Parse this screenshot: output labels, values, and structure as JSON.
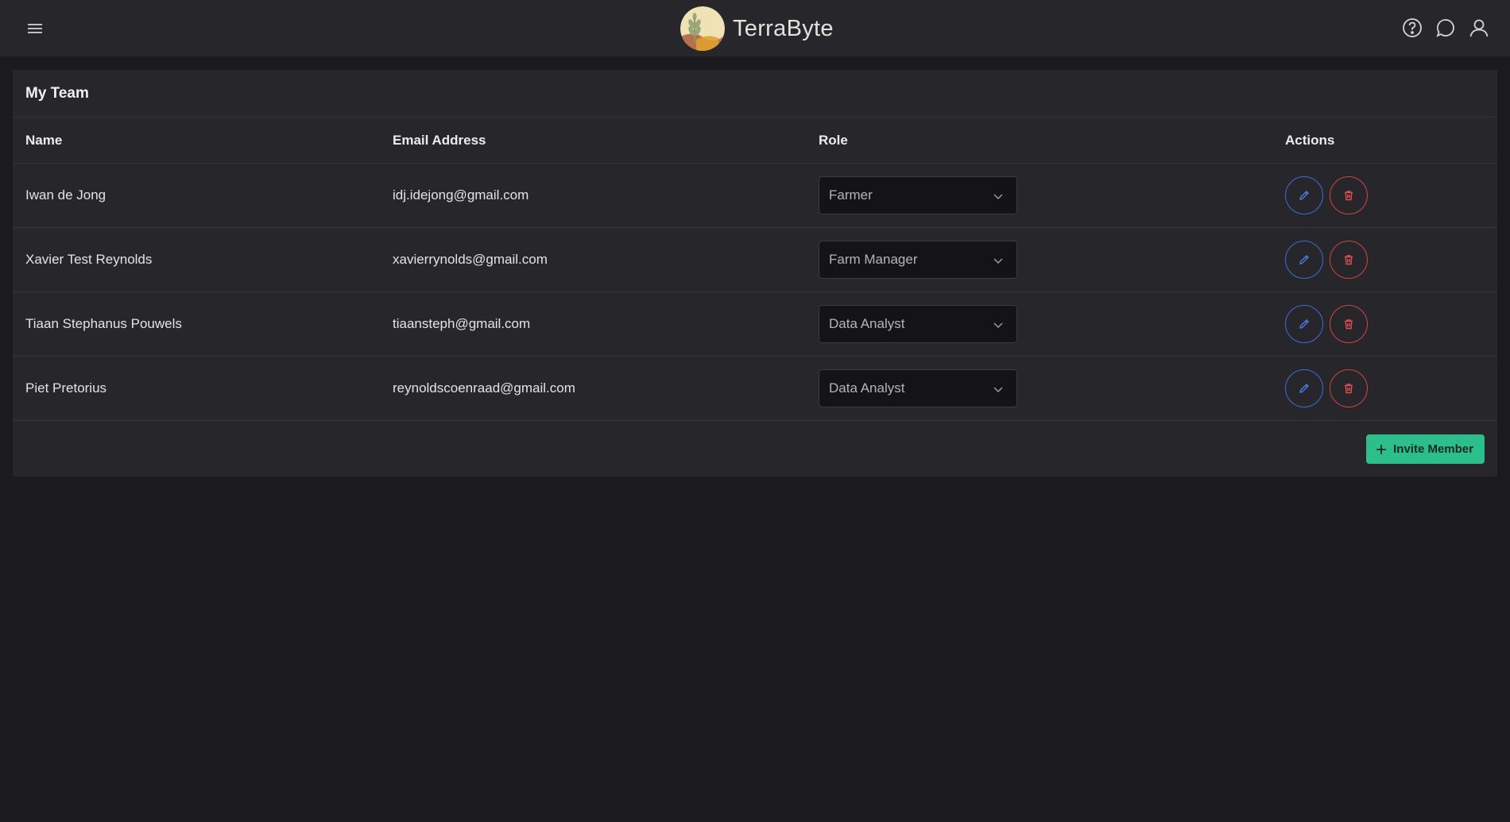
{
  "header": {
    "app_name": "TerraByte",
    "menu_icon": "hamburger-menu-icon",
    "icons": [
      "help-icon",
      "chat-icon",
      "user-icon"
    ]
  },
  "team": {
    "title": "My Team",
    "columns": {
      "name": "Name",
      "email": "Email Address",
      "role": "Role",
      "actions": "Actions"
    },
    "members": [
      {
        "name": "Iwan de Jong",
        "email": "idj.idejong@gmail.com",
        "role": "Farmer"
      },
      {
        "name": "Xavier Test Reynolds",
        "email": "xavierrynolds@gmail.com",
        "role": "Farm Manager"
      },
      {
        "name": "Tiaan Stephanus Pouwels",
        "email": "tiaansteph@gmail.com",
        "role": "Data Analyst"
      },
      {
        "name": "Piet Pretorius",
        "email": "reynoldscoenraad@gmail.com",
        "role": "Data Analyst"
      }
    ],
    "invite_label": "Invite Member"
  },
  "colors": {
    "accent_green": "#2cbf8c",
    "edit_blue": "#3f6fd8",
    "delete_red": "#d04545",
    "background": "#1a1a1f",
    "surface": "#26262b"
  }
}
